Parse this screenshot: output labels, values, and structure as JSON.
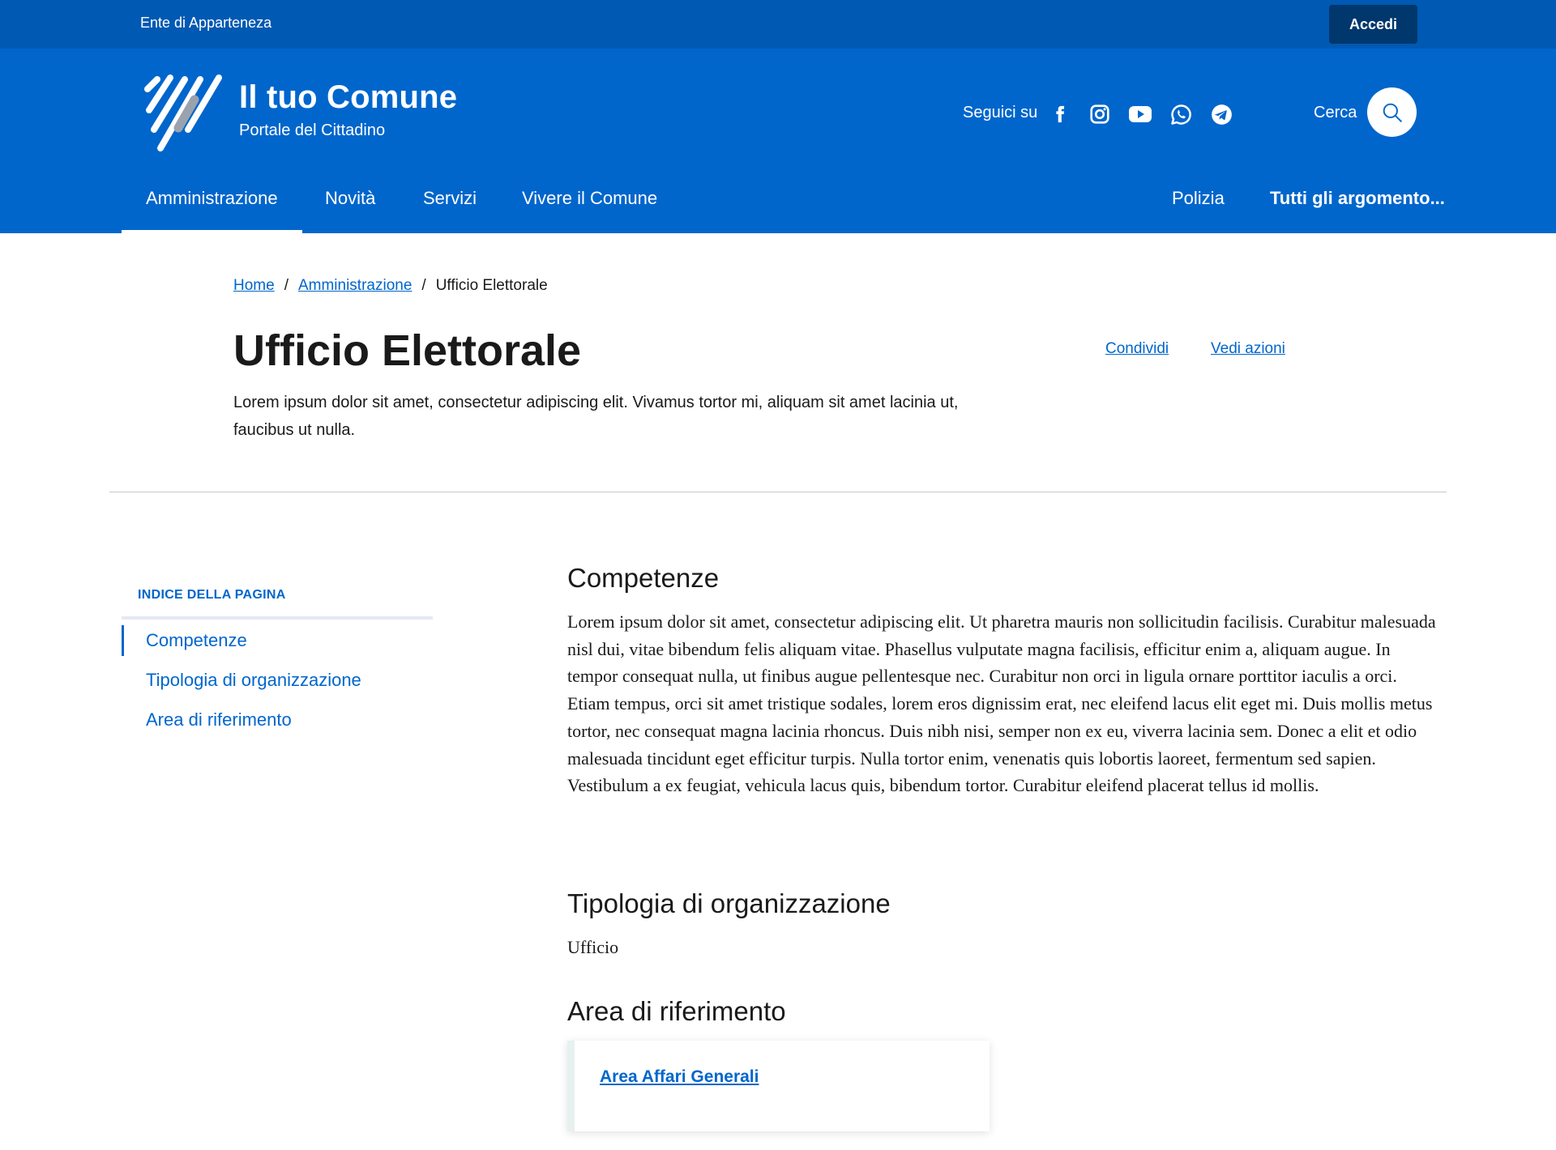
{
  "slim_header": {
    "ente": "Ente di Apparteneza",
    "login_label": "Accedi"
  },
  "brand": {
    "title": "Il tuo Comune",
    "subtitle": "Portale del Cittadino"
  },
  "social": {
    "label": "Seguici su",
    "icons": [
      "facebook-icon",
      "instagram-icon",
      "youtube-icon",
      "whatsapp-icon",
      "telegram-icon"
    ]
  },
  "search": {
    "label": "Cerca"
  },
  "nav": {
    "items": [
      "Amministrazione",
      "Novità",
      "Servizi",
      "Vivere il Comune"
    ],
    "secondary": [
      "Polizia",
      "Tutti gli argomento..."
    ]
  },
  "breadcrumb": {
    "home": "Home",
    "section": "Amministrazione",
    "current": "Ufficio Elettorale",
    "separator": "/"
  },
  "page": {
    "title": "Ufficio Elettorale",
    "lead": "Lorem ipsum dolor sit amet, consectetur adipiscing elit. Vivamus tortor mi, aliquam sit amet lacinia ut, faucibus ut nulla.",
    "share_label": "Condividi",
    "actions_label": "Vedi azioni"
  },
  "index": {
    "title": "INDICE DELLA PAGINA",
    "links": [
      "Competenze",
      "Tipologia di organizzazione",
      "Area di riferimento"
    ]
  },
  "sections": {
    "competenze": {
      "title": "Competenze",
      "text": "Lorem ipsum dolor sit amet, consectetur adipiscing elit. Ut pharetra mauris non sollicitudin facilisis. Curabitur malesuada nisl dui, vitae bibendum felis aliquam vitae. Phasellus vulputate magna facilisis, efficitur enim a, aliquam augue. In tempor consequat nulla, ut finibus augue pellentesque nec. Curabitur non orci in ligula ornare porttitor iaculis a orci. Etiam tempus, orci sit amet tristique sodales, lorem eros dignissim erat, nec eleifend lacus elit eget mi. Duis mollis metus tortor, nec consequat magna lacinia rhoncus. Duis nibh nisi, semper non ex eu, viverra lacinia sem. Donec a elit et odio malesuada tincidunt eget efficitur turpis. Nulla tortor enim, venenatis quis lobortis laoreet, fermentum sed sapien. Vestibulum a ex feugiat, vehicula lacus quis, bibendum tortor. Curabitur eleifend placerat tellus id mollis."
    },
    "tipologia": {
      "title": "Tipologia di organizzazione",
      "text": "Ufficio"
    },
    "area": {
      "title": "Area di riferimento",
      "card_link": "Area Affari Generali"
    }
  },
  "colors": {
    "slim_bg": "#0059b2",
    "header_bg": "#0066cc",
    "login_bg": "#00376d",
    "link": "#0066cc",
    "text": "#1a1a1a"
  }
}
